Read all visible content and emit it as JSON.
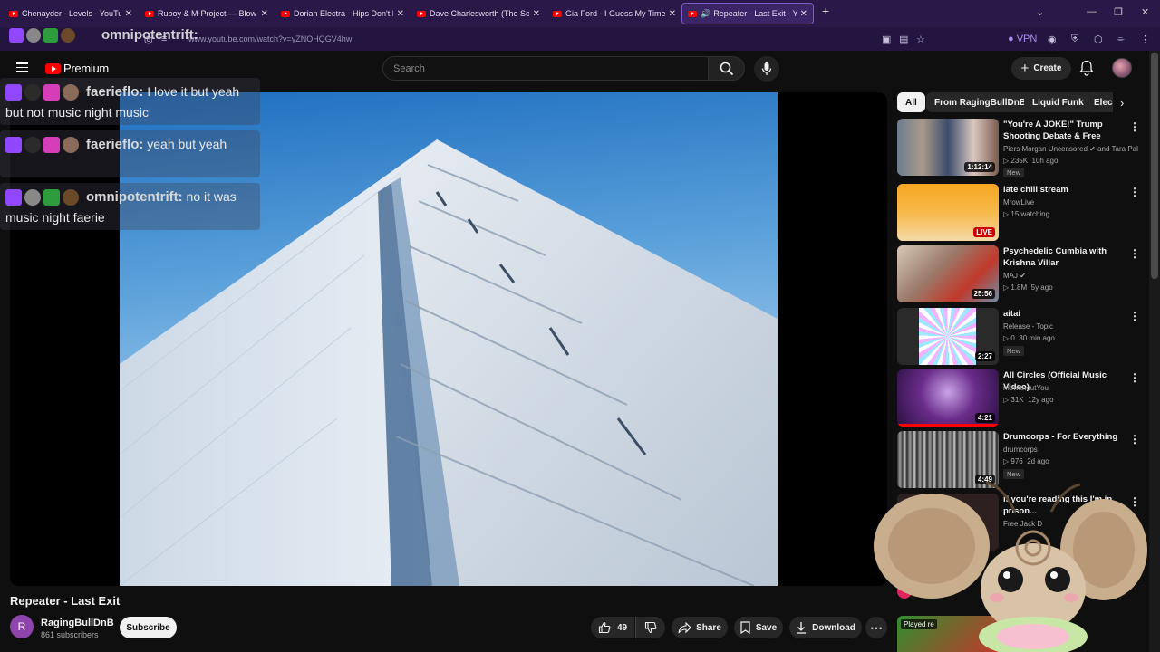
{
  "browser": {
    "tabs": [
      {
        "title": "Chenayder - Levels - YouTube"
      },
      {
        "title": "Ruboy & M-Project — Blow Yo"
      },
      {
        "title": "Dorian Electra - Hips Don't Lie"
      },
      {
        "title": "Dave Charlesworth (The Sorcer"
      },
      {
        "title": "Gia Ford - I Guess My Time Ha"
      },
      {
        "title": "Repeater - Last Exit - YouTu"
      }
    ],
    "url": "www.youtube.com/watch?v=yZNOHQGV4hw",
    "vpn_label": "VPN"
  },
  "header": {
    "logo_text": "Premium",
    "search_placeholder": "Search",
    "create_label": "Create"
  },
  "chat": {
    "messages": [
      {
        "user": "faerieflo:",
        "text": "I love it but yeah but not music night music"
      },
      {
        "user": "faerieflo:",
        "text": "yeah but yeah"
      },
      {
        "user": "omnipotentrift:",
        "text": "no it was music night faerie"
      }
    ],
    "top_user": "omnipotentrift:"
  },
  "video": {
    "title": "Repeater - Last Exit",
    "channel_initial": "R",
    "channel": "RagingBullDnB",
    "subscribers": "861 subscribers",
    "subscribe_label": "Subscribe",
    "likes": "49",
    "share_label": "Share",
    "save_label": "Save",
    "download_label": "Download"
  },
  "chips": [
    "All",
    "From RagingBullDnB",
    "Liquid Funk",
    "Elec"
  ],
  "recommendations": [
    {
      "title": "\"You're A JOKE!\" Trump Shooting Debate & Free Speec...",
      "channel": "Piers Morgan Uncensored",
      "channel_extra": "and Tara Pal",
      "views": "235K",
      "age": "10h ago",
      "duration": "1:12:14",
      "badge": "New"
    },
    {
      "title": "late chill stream",
      "channel": "MrowLive",
      "views": "15 watching",
      "age": "",
      "duration": "LIVE",
      "badge": ""
    },
    {
      "title": "Psychedelic Cumbia with Krishna Villar",
      "channel": "MAJ",
      "views": "1.8M",
      "age": "5y ago",
      "duration": "25:56",
      "badge": ""
    },
    {
      "title": "aitai",
      "channel": "Release - Topic",
      "views": "0",
      "age": "30 min ago",
      "duration": "2:27",
      "badge": "New"
    },
    {
      "title": "All Circles (Official Music Video)",
      "channel": "mewithoutYou",
      "views": "31K",
      "age": "12y ago",
      "duration": "4:21",
      "badge": ""
    },
    {
      "title": "Drumcorps - For Everything",
      "channel": "drumcorps",
      "views": "976",
      "age": "2d ago",
      "duration": "4:49",
      "badge": "New"
    },
    {
      "title": "if you're reading this I'm in prison...",
      "channel": "Free Jack D",
      "views": "",
      "age": "",
      "duration": "",
      "badge": ""
    }
  ],
  "extra": {
    "played_label": "Played re"
  },
  "colors": {
    "youtube_red": "#ff0000",
    "browser_tab_bg": "#2a1848",
    "page_bg": "#0f0f0f"
  }
}
